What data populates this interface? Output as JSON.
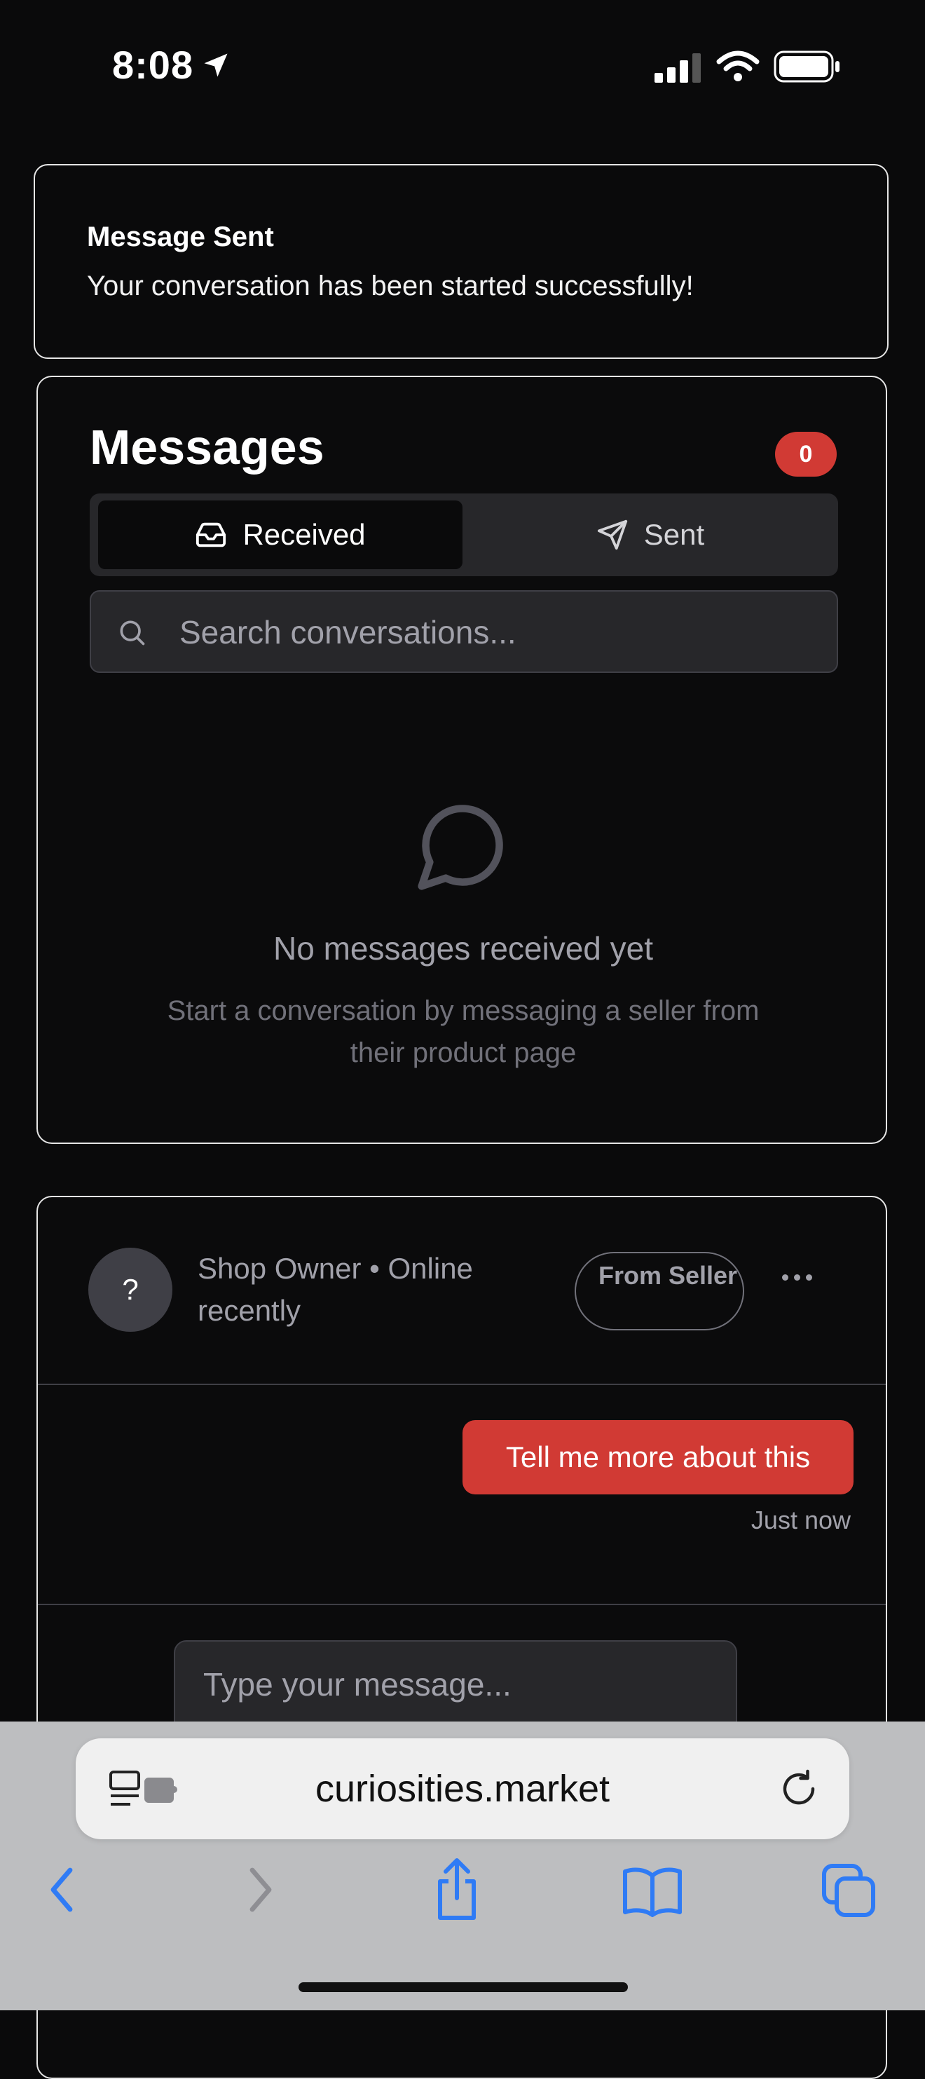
{
  "status_bar": {
    "time": "8:08"
  },
  "toast": {
    "title": "Message Sent",
    "description": "Your conversation has been started successfully!"
  },
  "messages": {
    "title": "Messages",
    "badge_count": "0",
    "tabs": [
      {
        "label": "Received",
        "icon": "inbox-icon",
        "active": true
      },
      {
        "label": "Sent",
        "icon": "send-icon",
        "active": false
      }
    ],
    "search_placeholder": "Search conversations...",
    "empty_state": {
      "icon": "message-circle-icon",
      "title": "No messages received yet",
      "description": "Start a conversation by messaging a seller from their product page"
    }
  },
  "conversation": {
    "avatar_initial": "?",
    "contact_status": "Shop Owner • Online recently",
    "tag": "From Seller",
    "messages": [
      {
        "text": "Tell me more about this",
        "time": "Just now",
        "accent": "#d13a34"
      }
    ],
    "composer_placeholder": "Type your message..."
  },
  "browser": {
    "url": "curiosities.market",
    "toolbar": [
      "back-icon",
      "forward-icon",
      "share-icon",
      "bookmarks-icon",
      "tabs-icon"
    ],
    "accent": "#2f7bf5"
  }
}
